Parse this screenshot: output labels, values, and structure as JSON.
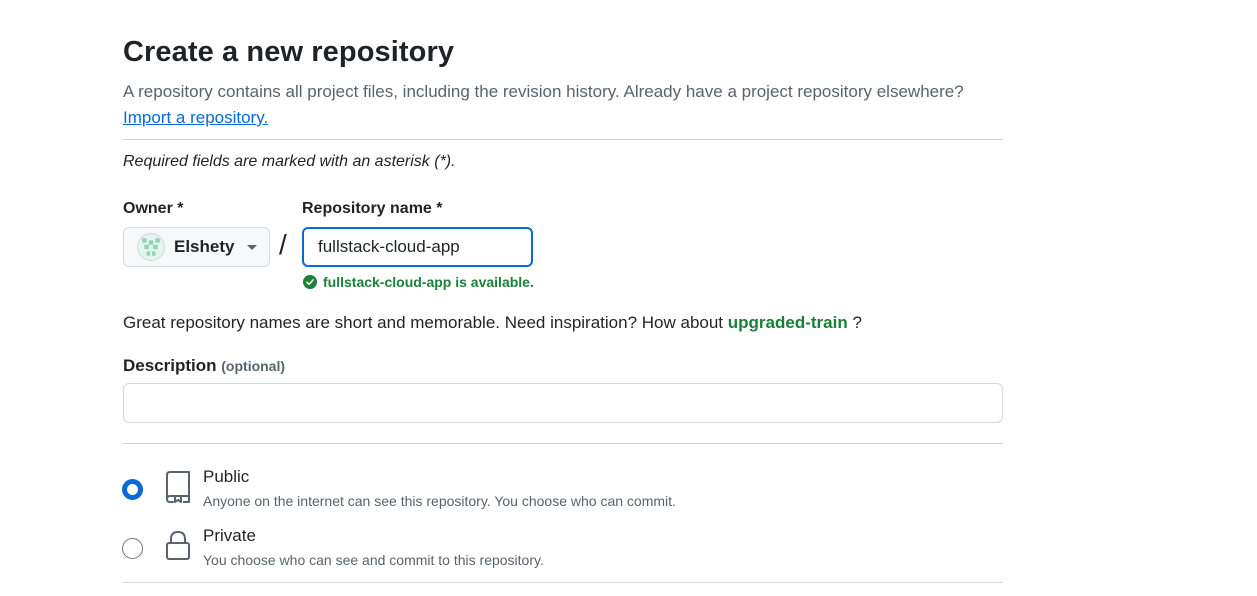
{
  "header": {
    "title": "Create a new repository",
    "subtitle": "A repository contains all project files, including the revision history. Already have a project repository elsewhere?",
    "import_link": "Import a repository."
  },
  "required_note": "Required fields are marked with an asterisk (*).",
  "owner": {
    "label": "Owner *",
    "name": "Elshety"
  },
  "separator": "/",
  "repo_name": {
    "label": "Repository name *",
    "value": "fullstack-cloud-app",
    "availability": "fullstack-cloud-app is available."
  },
  "suggestion": {
    "prefix": "Great repository names are short and memorable. Need inspiration? How about",
    "name": "upgraded-train",
    "suffix": "?"
  },
  "description": {
    "label": "Description",
    "optional": "(optional)",
    "value": ""
  },
  "visibility": {
    "options": [
      {
        "title": "Public",
        "desc": "Anyone on the internet can see this repository. You choose who can commit.",
        "selected": true,
        "icon": "repo-icon"
      },
      {
        "title": "Private",
        "desc": "You choose who can see and commit to this repository.",
        "selected": false,
        "icon": "lock-icon"
      }
    ]
  },
  "colors": {
    "accent": "#0969da",
    "success": "#1a7f37",
    "muted": "#59636e",
    "border": "#d1d9e0"
  }
}
